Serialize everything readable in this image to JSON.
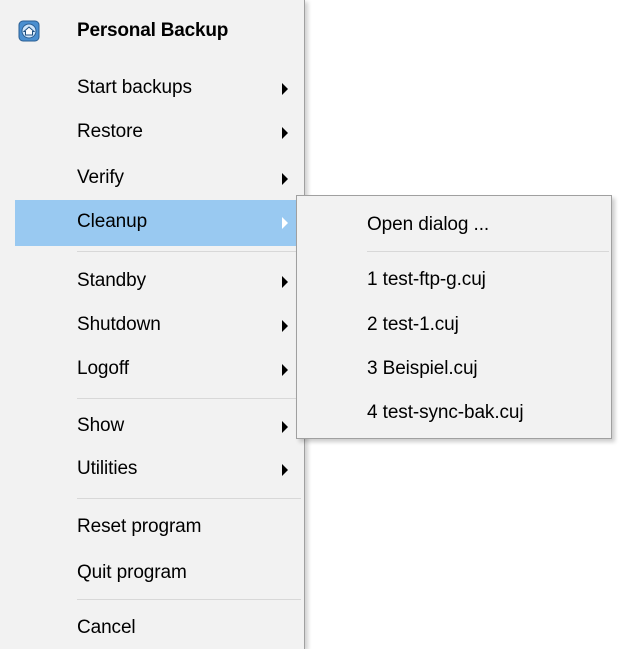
{
  "menu": {
    "title": "Personal Backup",
    "app_icon": "personal-backup-house-icon",
    "items": [
      {
        "label": "Start backups",
        "has_submenu": true
      },
      {
        "label": "Restore",
        "has_submenu": true
      },
      {
        "label": "Verify",
        "has_submenu": true
      },
      {
        "label": "Cleanup",
        "has_submenu": true,
        "highlighted": true
      },
      {
        "label": "Standby",
        "has_submenu": true
      },
      {
        "label": "Shutdown",
        "has_submenu": true
      },
      {
        "label": "Logoff",
        "has_submenu": true
      },
      {
        "label": "Show",
        "has_submenu": true
      },
      {
        "label": "Utilities",
        "has_submenu": true
      },
      {
        "label": "Reset program",
        "has_submenu": false
      },
      {
        "label": "Quit program",
        "has_submenu": false
      },
      {
        "label": "Cancel",
        "has_submenu": false
      }
    ]
  },
  "submenu": {
    "items": [
      {
        "label": "Open dialog ..."
      },
      {
        "label": "1 test-ftp-g.cuj"
      },
      {
        "label": "2 test-1.cuj"
      },
      {
        "label": "3 Beispiel.cuj"
      },
      {
        "label": "4 test-sync-bak.cuj"
      }
    ]
  },
  "colors": {
    "menu_background": "#f2f2f2",
    "highlight": "#99c9f1",
    "separator": "#d8d8d8",
    "border": "#a0a0a0"
  }
}
